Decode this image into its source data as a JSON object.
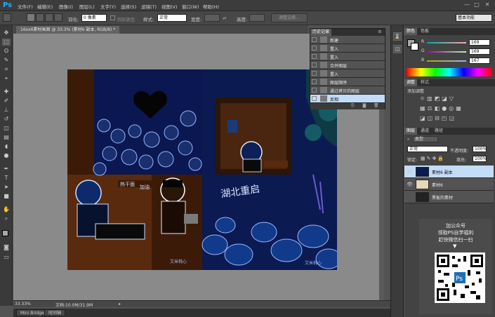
{
  "app": {
    "logo": "Ps",
    "accent": "#31a8ff"
  },
  "menu": [
    "文件(F)",
    "编辑(E)",
    "图像(I)",
    "图层(L)",
    "文字(Y)",
    "选择(S)",
    "滤镜(T)",
    "视图(V)",
    "窗口(W)",
    "帮助(H)"
  ],
  "window_controls": [
    "—",
    "□",
    "✕"
  ],
  "options": {
    "feather_label": "羽化:",
    "feather_value": "0 像素",
    "antialias_label": "消除锯齿",
    "style_label": "样式:",
    "style_value": "正常",
    "width_label": "宽度:",
    "height_label": "高度:",
    "refine_edge": "调整边缘...",
    "workspace": "基本功能"
  },
  "document": {
    "tab_title": "16xx6素材画面 @ 33.3% (素材6 副本, RGB/8) *",
    "zoom": "33.33%",
    "doc_size": "文档:10.0M/31.9M"
  },
  "artwork": {
    "headline": "湖北重启",
    "sign": "热干面",
    "sign2": "加油",
    "sig_left": "艾米桃心",
    "sig_right": "艾米桃心"
  },
  "bottom_tabs": [
    "Mini Bridge",
    "时间轴"
  ],
  "history": {
    "tabs": [
      "历史记录"
    ],
    "items": [
      {
        "label": "新建",
        "selected": false
      },
      {
        "label": "置入",
        "selected": false
      },
      {
        "label": "置入",
        "selected": false
      },
      {
        "label": "合并图层",
        "selected": false
      },
      {
        "label": "置入",
        "selected": false
      },
      {
        "label": "图层顺序",
        "selected": false
      },
      {
        "label": "通过拷贝的图层",
        "selected": false
      },
      {
        "label": "反相",
        "selected": true
      }
    ]
  },
  "color_panel": {
    "tabs": [
      "颜色",
      "色板"
    ],
    "channels": [
      {
        "name": "R",
        "value": "169"
      },
      {
        "name": "G",
        "value": "169"
      },
      {
        "name": "B",
        "value": "167"
      }
    ]
  },
  "adjust_panel": {
    "tabs": [
      "调整",
      "样式"
    ],
    "title": "添加调整"
  },
  "layers_panel": {
    "tabs": [
      "图层",
      "通道",
      "路径"
    ],
    "kind_filter": "类型",
    "blend_mode": "正常",
    "opacity_label": "不透明度:",
    "opacity_value": "100%",
    "lock_label": "锁定:",
    "fill_label": "填充:",
    "fill_value": "100%",
    "layers": [
      {
        "name": "素材6 副本",
        "selected": true,
        "visible": true
      },
      {
        "name": "素材6",
        "selected": false,
        "visible": true
      },
      {
        "name": "黑板的素材",
        "selected": false,
        "visible": false
      }
    ]
  },
  "promo": {
    "line1": "加公众号",
    "line2": "领取PS自学福利",
    "line3": "赶快微信扫一扫"
  }
}
